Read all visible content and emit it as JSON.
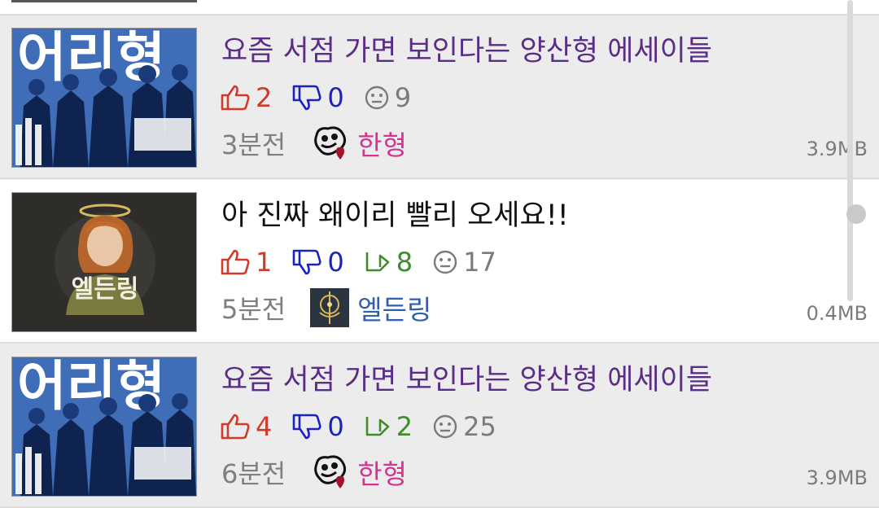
{
  "posts": [
    {
      "title": "요즘 서점 가면 보인다는 양산형 에세이들",
      "read": true,
      "likes": "2",
      "dislikes": "0",
      "comments": "9",
      "time": "3분전",
      "board": "한형",
      "size": "3.9MB"
    },
    {
      "title": "아 진짜 왜이리 빨리 오세요!!",
      "read": false,
      "likes": "1",
      "dislikes": "0",
      "shares": "8",
      "comments": "17",
      "time": "5분전",
      "board": "엘든링",
      "size": "0.4MB"
    },
    {
      "title": "요즘 서점 가면 보인다는 양산형 에세이들",
      "read": true,
      "likes": "4",
      "dislikes": "0",
      "shares": "2",
      "comments": "25",
      "time": "6분전",
      "board": "한형",
      "size": "3.9MB"
    }
  ],
  "thumbnails": {
    "hanhyung_text": "어리형",
    "elden_text": "엘든링"
  },
  "colors": {
    "read_title": "#5a2e86",
    "unread_title": "#111111",
    "like": "#d03a2a",
    "dislike": "#1a22c2",
    "share": "#3f8c2a",
    "hanhyung_board": "#d2358f",
    "elden_board": "#2f5fb0"
  },
  "icons": [
    "thumbs-up-icon",
    "thumbs-down-icon",
    "share-icon",
    "comment-face-icon",
    "hanhyung-board-icon",
    "elden-board-icon"
  ]
}
